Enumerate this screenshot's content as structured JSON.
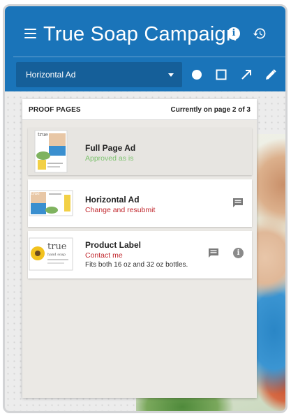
{
  "header": {
    "title": "True Soap Campaign",
    "info_icon": "info-icon",
    "history_icon": "history-icon",
    "menu_icon": "menu-icon"
  },
  "toolbar": {
    "selected_page": "Horizontal Ad",
    "tools": [
      "circle-tool-icon",
      "rectangle-tool-icon",
      "arrow-tool-icon",
      "pencil-tool-icon"
    ]
  },
  "panel": {
    "heading": "PROOF PAGES",
    "current_page": "Currently on page 2 of 3"
  },
  "pages": [
    {
      "title": "Full Page Ad",
      "status": "Approved as is",
      "note": "",
      "has_comment": false,
      "has_info": false
    },
    {
      "title": "Horizontal Ad",
      "status": "Change and resubmit",
      "note": "",
      "has_comment": true,
      "has_info": false
    },
    {
      "title": "Product Label",
      "status": "Contact me",
      "note": "Fits both 16 oz and 32 oz bottles.",
      "has_comment": true,
      "has_info": true
    }
  ],
  "thumbnails": {
    "label_brand": "true",
    "label_sub": "hand soap"
  },
  "colors": {
    "header": "#1a74b9",
    "dropdown": "#155f99",
    "approved": "#7cc26d",
    "rejected": "#c1272d"
  }
}
